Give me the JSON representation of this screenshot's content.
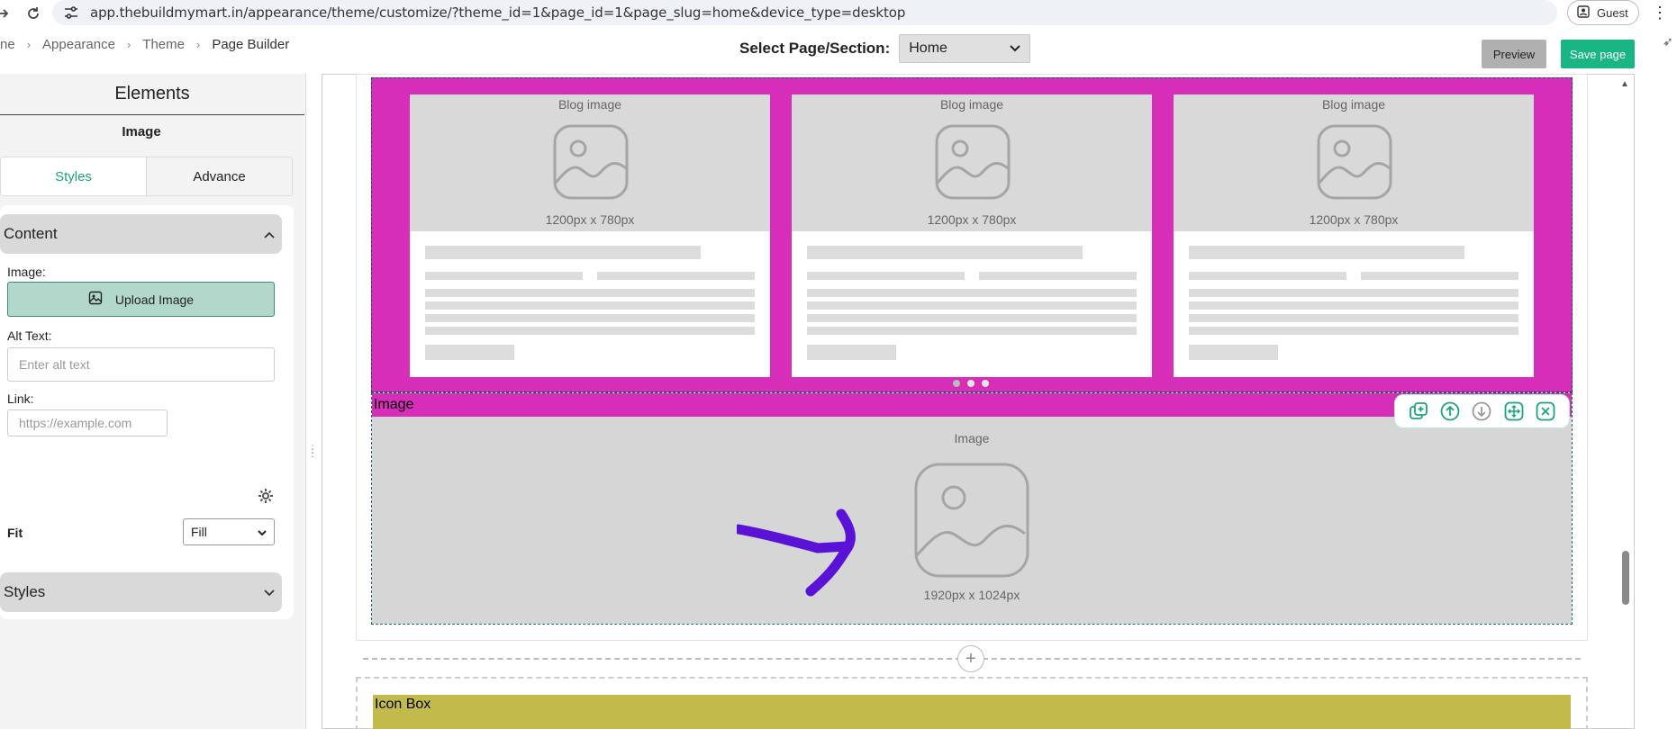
{
  "browser": {
    "url": "app.thebuildmymart.in/appearance/theme/customize/?theme_id=1&page_id=1&page_slug=home&device_type=desktop",
    "profile_label": "Guest"
  },
  "breadcrumb": {
    "items": [
      "ne",
      "Appearance",
      "Theme",
      "Page Builder"
    ]
  },
  "header": {
    "select_label": "Select Page/Section:",
    "selected_page": "Home",
    "preview_label": "Preview",
    "save_label": "Save page"
  },
  "panel": {
    "title": "Elements",
    "element_name": "Image",
    "tabs": [
      {
        "label": "Styles",
        "active": true
      },
      {
        "label": "Advance",
        "active": false
      }
    ],
    "content_section": {
      "title": "Content",
      "image_label": "Image:",
      "upload_label": "Upload Image",
      "alt_label": "Alt Text:",
      "alt_placeholder": "Enter alt text",
      "link_label": "Link:",
      "link_placeholder": "https://example.com",
      "fit_label": "Fit",
      "fit_value": "Fill"
    },
    "styles_section": {
      "title": "Styles"
    }
  },
  "canvas": {
    "blog_cards": [
      {
        "image_label": "Blog image",
        "size_label": "1200px x 780px"
      },
      {
        "image_label": "Blog image",
        "size_label": "1200px x 780px"
      },
      {
        "image_label": "Blog image",
        "size_label": "1200px x 780px"
      }
    ],
    "image_block": {
      "label": "Image",
      "placeholder_label": "Image",
      "size_label": "1920px x 1024px"
    },
    "icon_box_label": "Icon Box"
  },
  "colors": {
    "accent": "#19b585",
    "blog_bg": "#d62eb8",
    "icon_box_bg": "#c2bb4c",
    "annotation": "#5a12d6"
  }
}
